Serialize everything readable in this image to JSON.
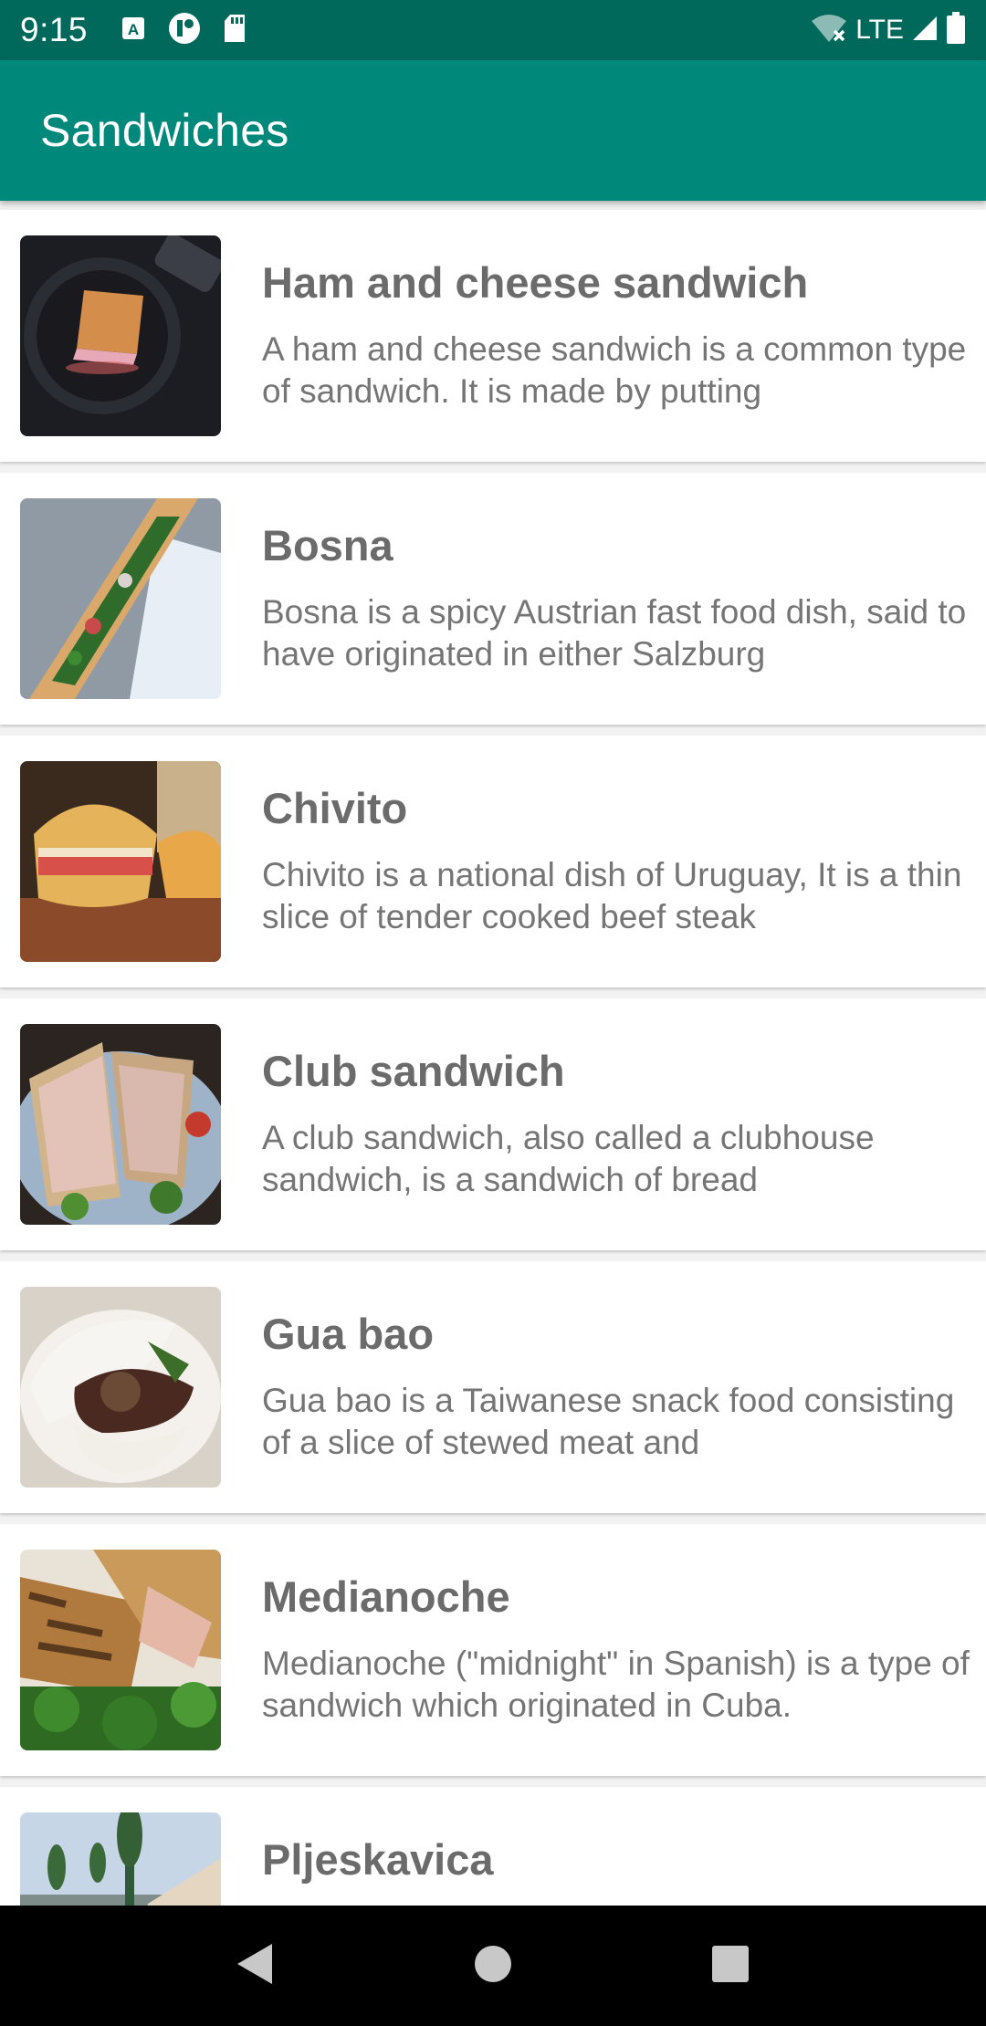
{
  "status_bar": {
    "time": "9:15",
    "network": "LTE",
    "icons": [
      "a-box-icon",
      "app-notification-icon",
      "sd-card-icon",
      "wifi-off-icon",
      "signal-icon",
      "battery-icon"
    ]
  },
  "app_bar": {
    "title": "Sandwiches",
    "color": "#00897b",
    "status_color": "#00695c"
  },
  "items": [
    {
      "title": "Ham and cheese sandwich",
      "desc": "A ham and cheese sandwich is a common type of sandwich. It is made by putting"
    },
    {
      "title": "Bosna",
      "desc": "Bosna is a spicy Austrian fast food dish, said to have originated in either Salzburg"
    },
    {
      "title": "Chivito",
      "desc": "Chivito is a national dish of Uruguay, It is a thin slice of tender cooked beef steak"
    },
    {
      "title": "Club sandwich",
      "desc": "A club sandwich, also called a clubhouse sandwich, is a sandwich of bread"
    },
    {
      "title": "Gua bao",
      "desc": "Gua bao is a Taiwanese snack food consisting of a slice of stewed meat and"
    },
    {
      "title": "Medianoche",
      "desc": "Medianoche (\"midnight\" in Spanish) is a type of sandwich which originated in Cuba."
    },
    {
      "title": "Pljeskavica",
      "desc": ""
    }
  ],
  "nav_bar": {
    "buttons": [
      "back-icon",
      "home-icon",
      "recents-icon"
    ]
  }
}
